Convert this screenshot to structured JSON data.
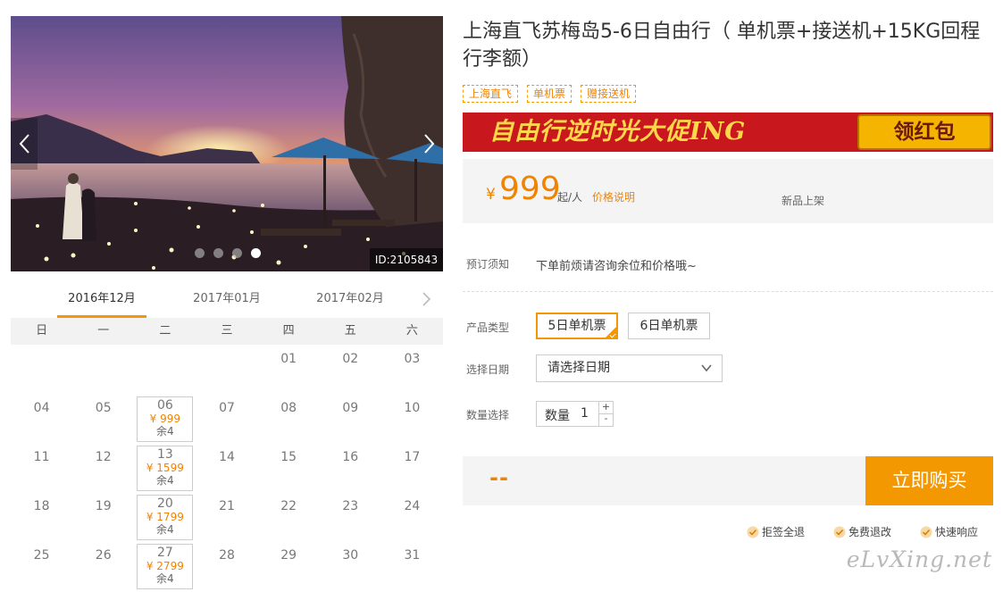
{
  "gallery": {
    "id_tag": "ID:2105843",
    "slide_count": 4,
    "active_slide": 4
  },
  "calendar": {
    "months": [
      {
        "label": "2016年12月",
        "active": true
      },
      {
        "label": "2017年01月",
        "active": false
      },
      {
        "label": "2017年02月",
        "active": false
      }
    ],
    "weekdays": [
      "日",
      "一",
      "二",
      "三",
      "四",
      "五",
      "六"
    ],
    "days": [
      {
        "d": ""
      },
      {
        "d": ""
      },
      {
        "d": ""
      },
      {
        "d": ""
      },
      {
        "d": "01"
      },
      {
        "d": "02"
      },
      {
        "d": "03"
      },
      {
        "d": "04"
      },
      {
        "d": "05"
      },
      {
        "d": "06",
        "price": "¥ 999",
        "remain": "余4"
      },
      {
        "d": "07"
      },
      {
        "d": "08"
      },
      {
        "d": "09"
      },
      {
        "d": "10"
      },
      {
        "d": "11"
      },
      {
        "d": "12"
      },
      {
        "d": "13",
        "price": "¥ 1599",
        "remain": "余4"
      },
      {
        "d": "14"
      },
      {
        "d": "15"
      },
      {
        "d": "16"
      },
      {
        "d": "17"
      },
      {
        "d": "18"
      },
      {
        "d": "19"
      },
      {
        "d": "20",
        "price": "¥ 1799",
        "remain": "余4"
      },
      {
        "d": "21"
      },
      {
        "d": "22"
      },
      {
        "d": "23"
      },
      {
        "d": "24"
      },
      {
        "d": "25"
      },
      {
        "d": "26"
      },
      {
        "d": "27",
        "price": "¥ 2799",
        "remain": "余4"
      },
      {
        "d": "28"
      },
      {
        "d": "29"
      },
      {
        "d": "30"
      },
      {
        "d": "31"
      }
    ]
  },
  "product": {
    "title": "上海直飞苏梅岛5-6日自由行（ 单机票+接送机+15KG回程行李额）",
    "tags": [
      "上海直飞",
      "单机票",
      "赠接送机"
    ],
    "banner": {
      "slogan": "自由行逆时光大促ING",
      "button": "领红包"
    },
    "price": {
      "currency": "¥",
      "amount": "999",
      "unit": "起/人",
      "explain": "价格说明",
      "badge": "新品上架"
    }
  },
  "booking": {
    "notice_label": "预订须知",
    "notice_text": "下单前烦请咨询余位和价格哦~",
    "type_label": "产品类型",
    "types": [
      {
        "label": "5日单机票",
        "selected": true
      },
      {
        "label": "6日单机票",
        "selected": false
      }
    ],
    "date_label": "选择日期",
    "date_placeholder": "请选择日期",
    "qty_label": "数量选择",
    "qty_prefix": "数量",
    "qty_value": "1",
    "qty_plus": "+",
    "qty_minus": "-",
    "total": "--",
    "buy_button": "立即购买"
  },
  "guarantees": [
    "拒签全退",
    "免费退改",
    "快速响应"
  ],
  "watermark": "eLvXing.net",
  "colors": {
    "accent": "#f39800",
    "price": "#f08300",
    "banner": "#c8171d"
  }
}
